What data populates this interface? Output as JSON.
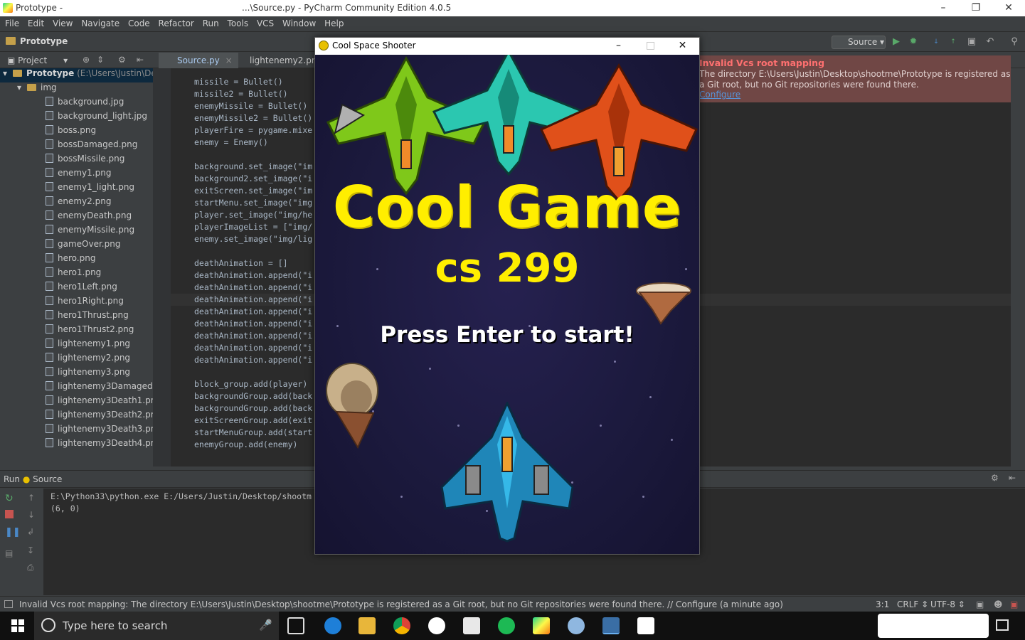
{
  "ide": {
    "title_left": "Prototype -",
    "title_right": "...\\Source.py - PyCharm Community Edition 4.0.5",
    "menu": [
      "File",
      "Edit",
      "View",
      "Navigate",
      "Code",
      "Refactor",
      "Run",
      "Tools",
      "VCS",
      "Window",
      "Help"
    ],
    "breadcrumb": "Prototype",
    "run_config": "Source",
    "project_label": "Project",
    "tabs": [
      "Source.py",
      "lightenemy2.png"
    ],
    "tree_root": "Prototype",
    "tree_root_path": "(E:\\Users\\Justin\\De",
    "tree_folder": "img",
    "files": [
      "background.jpg",
      "background_light.jpg",
      "boss.png",
      "bossDamaged.png",
      "bossMissile.png",
      "enemy1.png",
      "enemy1_light.png",
      "enemy2.png",
      "enemyDeath.png",
      "enemyMissile.png",
      "gameOver.png",
      "hero.png",
      "hero1.png",
      "hero1Left.png",
      "hero1Right.png",
      "hero1Thrust.png",
      "hero1Thrust2.png",
      "lightenemy1.png",
      "lightenemy2.png",
      "lightenemy3.png",
      "lightenemy3Damaged.",
      "lightenemy3Death1.pn",
      "lightenemy3Death2.pn",
      "lightenemy3Death3.pn",
      "lightenemy3Death4.pn"
    ],
    "code": [
      "missile = Bullet()",
      "missile2 = Bullet()",
      "enemyMissile = Bullet()",
      "enemyMissile2 = Bullet()",
      "playerFire = pygame.mixe",
      "enemy = Enemy()",
      "",
      "background.set_image(\"im",
      "background2.set_image(\"i",
      "exitScreen.set_image(\"im",
      "startMenu.set_image(\"img",
      "player.set_image(\"img/he",
      "playerImageList = [\"img/",
      "enemy.set_image(\"img/lig",
      "",
      "deathAnimation = []",
      "deathAnimation.append(\"i",
      "deathAnimation.append(\"i",
      "deathAnimation.append(\"i",
      "deathAnimation.append(\"i",
      "deathAnimation.append(\"i",
      "deathAnimation.append(\"i",
      "deathAnimation.append(\"i",
      "deathAnimation.append(\"i",
      "",
      "block_group.add(player)",
      "backgroundGroup.add(back",
      "backgroundGroup.add(back",
      "exitScreenGroup.add(exit",
      "startMenuGroup.add(start",
      "enemyGroup.add(enemy)"
    ],
    "notification": {
      "title": "Invalid Vcs root mapping",
      "body": "The directory E:\\Users\\Justin\\Desktop\\shootme\\Prototype is registered as a Git root, but no Git repositories were found there.",
      "link": "Configure"
    },
    "run_tab": "Run",
    "run_name": "Source",
    "console": [
      "E:\\Python33\\python.exe E:/Users/Justin/Desktop/shootm",
      "(6, 0)"
    ],
    "status_msg": "Invalid Vcs root mapping: The directory E:\\Users\\Justin\\Desktop\\shootme\\Prototype is registered as a Git root, but no Git repositories were found there. // Configure (a minute ago)",
    "status_pos": "3:1",
    "status_eol": "CRLF",
    "status_enc": "UTF-8"
  },
  "game": {
    "window_title": "Cool Space Shooter",
    "title": "Cool Game",
    "subtitle": "cs 299",
    "prompt": "Press Enter to start!"
  },
  "taskbar": {
    "search_placeholder": "Type here to search"
  }
}
